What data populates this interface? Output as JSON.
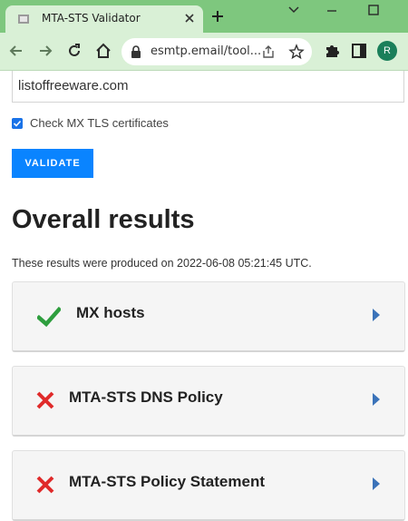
{
  "browser": {
    "tab_title": "MTA-STS Validator",
    "url": "esmtp.email/tool...",
    "profile_initial": "R"
  },
  "form": {
    "domain_value": "listoffreeware.com",
    "check_mx_label": "Check MX TLS certificates",
    "check_mx_checked": true,
    "validate_label": "VALIDATE"
  },
  "results": {
    "heading": "Overall results",
    "produced_text": "These results were produced on 2022-06-08 05:21:45 UTC.",
    "items": [
      {
        "title": "MX hosts",
        "status": "pass",
        "status_icon": "check-icon"
      },
      {
        "title": "MTA-STS DNS Policy",
        "status": "fail",
        "status_icon": "cross-icon"
      },
      {
        "title": "MTA-STS Policy Statement",
        "status": "fail",
        "status_icon": "cross-icon"
      }
    ]
  },
  "colors": {
    "chrome_green": "#7ec77e",
    "toolbar_green": "#d9f0d6",
    "accent_blue": "#0a84ff",
    "pass_green": "#2e9e3e",
    "fail_red": "#e02b2b",
    "arrow_blue": "#3b73b9"
  }
}
